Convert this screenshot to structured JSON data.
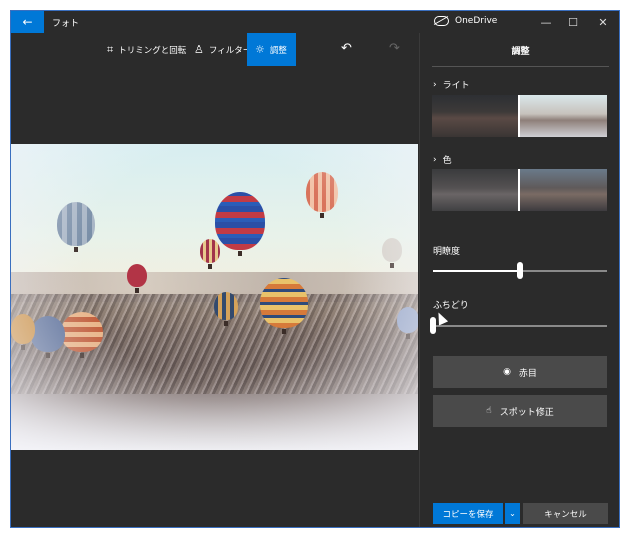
{
  "titlebar": {
    "back_icon": "←",
    "app_title": "フォト",
    "onedrive_label": "OneDrive",
    "minimize": "—",
    "maximize": "☐",
    "close": "✕"
  },
  "toolbar": {
    "crop_label": "トリミングと回転",
    "filter_label": "フィルター",
    "adjust_label": "調整",
    "undo_icon": "↶",
    "redo_icon": "↷"
  },
  "panel": {
    "title": "調整",
    "light_label": "ライト",
    "color_label": "色",
    "chevron": "›",
    "clarity_label": "明瞭度",
    "clarity_value": 0.5,
    "vignette_label": "ふちどり",
    "vignette_value": 0.0,
    "red_eye_label": "赤目",
    "red_eye_icon": "eye-icon",
    "spot_fix_label": "スポット修正",
    "spot_fix_icon": "hand-icon"
  },
  "footer": {
    "save_copy_label": "コピーを保存",
    "save_dropdown": "⌄",
    "cancel_label": "キャンセル"
  },
  "colors": {
    "accent": "#0078d7",
    "background": "#2b2b2b",
    "button": "#4a4a4a"
  }
}
